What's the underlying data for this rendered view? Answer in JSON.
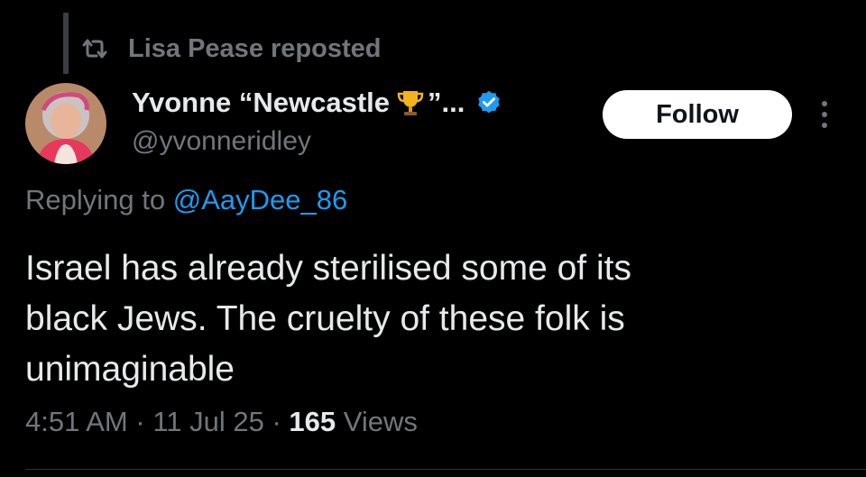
{
  "repost": {
    "icon": "repost-icon",
    "label": "Lisa Pease reposted"
  },
  "author": {
    "display_name": "Yvonne “Newcastle",
    "name_emoji": "trophy-icon",
    "name_suffix": "”...",
    "handle": "@yvonneridley",
    "verified_icon": "verified-badge-icon",
    "verified_color": "#1d9bf0"
  },
  "actions": {
    "follow_label": "Follow",
    "more_icon": "more-options-icon"
  },
  "reply": {
    "prefix": "Replying to",
    "mention": "@AayDee_86"
  },
  "tweet": {
    "lines": [
      "Israel has already sterilised some of its",
      "black Jews. The cruelty of these folk is",
      "unimaginable"
    ]
  },
  "meta": {
    "time": "4:51 AM",
    "date": "11 Jul 25",
    "views_count": "165",
    "views_label": "Views",
    "separator": "·"
  },
  "colors": {
    "background": "#000000",
    "primary_text": "#e7e9ea",
    "secondary_text": "#71767b",
    "accent": "#1d9bf0",
    "follow_button_bg": "#ffffff"
  }
}
